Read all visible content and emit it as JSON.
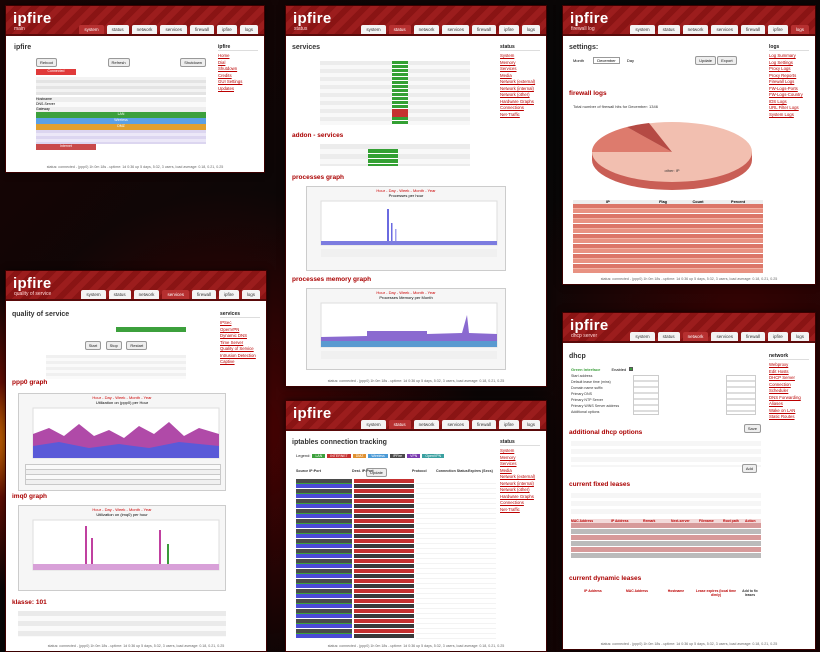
{
  "brand": "ipfire",
  "status_text": "status: connected - (ppp0) 1h 0m 18s - uptime: 1d 0:36 up 5 days, 5:32, 3 users, load average: 0.18, 0.21, 0.25",
  "tabs": [
    "system",
    "status",
    "network",
    "services",
    "firewall",
    "ipfire",
    "logs"
  ],
  "panels": {
    "ipfire": {
      "subtitle": "main",
      "title": "ipfire",
      "buttons": [
        "Reboot",
        "Refresh",
        "Shutdown"
      ],
      "connected": "Connected",
      "row_labels": [
        "Hostname",
        "DNS-Server",
        "Gateway",
        "LAN",
        "Wireless",
        "DMZ",
        "Internet"
      ],
      "sidebar_title": "ipfire",
      "sidebar": [
        "Home",
        "Dial",
        "Shutdown",
        "Credits",
        "GUI Settings",
        "Updates"
      ]
    },
    "services": {
      "subtitle": "status",
      "title": "services",
      "addon_title": "addon - services",
      "graph1_title": "processes graph",
      "graph1_heading": "Processes per hour",
      "graph2_title": "processes memory graph",
      "graph2_heading": "Processes Memory per Month",
      "range_links": "Hour - Day - Week - Month - Year",
      "running": "RUNNING",
      "stopped": "STOPPED",
      "sidebar_title": "status",
      "sidebar": [
        "System",
        "Memory",
        "Services",
        "Media",
        "Network (external)",
        "Network (internal)",
        "Network (other)",
        "Hardware Graphs",
        "Connections",
        "Net-Traffic"
      ]
    },
    "logs": {
      "subtitle": "firewall log",
      "title": "settings:",
      "fwlogs_title": "firewall logs",
      "bar_caption": "Total number of firewall hits for December: 1346",
      "month_label": "Month",
      "month_value": "December",
      "day_label": "Day",
      "update_btn": "Update",
      "export_btn": "Export",
      "pie_label": "other: IP",
      "cols": [
        "IP",
        "Flag",
        "Count",
        "Percent"
      ],
      "sidebar_title": "logs",
      "sidebar": [
        "Log Summary",
        "Log Settings",
        "Proxy Logs",
        "Proxy Reports",
        "Firewall Logs",
        "FW-Logs-Ports",
        "FW-Logs-Country",
        "IDS Logs",
        "URL Filter Logs",
        "System Logs"
      ]
    },
    "qos": {
      "subtitle": "quality of service",
      "title": "quality of service",
      "graph1_title": "ppp0 graph",
      "graph1_heading": "Utilization on (ppp0) per Hour",
      "graph2_title": "imq0 graph",
      "graph2_heading": "Utilization on (imq0) per hour",
      "classes_title": "klasse: 101",
      "range_links": "Hour - Day - Week - Month - Year",
      "buttons": [
        "Start",
        "Stop",
        "Restart"
      ],
      "sidebar_title": "services",
      "sidebar": [
        "IPSec",
        "OpenVPN",
        "Dynamic DNS",
        "Time Server",
        "Quality of Service",
        "Intrusion Detection",
        "Captive"
      ]
    },
    "conntrack": {
      "title": "iptables connection tracking",
      "legend_label": "Legend:",
      "legend": [
        "LAN",
        "INTERNET",
        "DMZ",
        "Wireless",
        "IPFire",
        "VPN",
        "OpenVPN"
      ],
      "update_btn": "Update",
      "cols": [
        "Source IP:Port",
        "Dest. IP:Port",
        "Protocol",
        "Connection Status",
        "Expires (Secs)"
      ],
      "sidebar_title": "status",
      "sidebar": [
        "System",
        "Memory",
        "Services",
        "Media",
        "Network (external)",
        "Network (internal)",
        "Network (other)",
        "Hardware Graphs",
        "Connections",
        "Net-Traffic"
      ]
    },
    "dhcp": {
      "subtitle": "dhcp server",
      "title": "dhcp",
      "green_iface": "Green Interface",
      "enabled": "Enabled",
      "field_labels": [
        "Start address",
        "Default lease time (mins)",
        "Domain name suffix",
        "Primary DNS",
        "Primary NTP Server",
        "Primary WINS Server address",
        "Additional options"
      ],
      "opts_title": "additional dhcp options",
      "fixed_title": "current fixed leases",
      "dynamic_title": "current dynamic leases",
      "save_btn": "Save",
      "add_btn": "Add",
      "fixed_cols": [
        "MAC Address",
        "IP Address",
        "Remark",
        "Next-server",
        "Filename",
        "Root path",
        "Action"
      ],
      "dyn_cols": [
        "IP Address",
        "MAC Address",
        "Hostname",
        "Lease expires (local time d/m/y)",
        "Add to fix leases"
      ],
      "sidebar_title": "network",
      "sidebar": [
        "Webproxy",
        "Edit Hosts",
        "DHCP Server",
        "Connection Scheduler",
        "DNS Forwarding",
        "Aliases",
        "Wake on LAN",
        "Static Routes"
      ]
    }
  },
  "colors": {
    "brand_red": "#9c1d1d",
    "green": "#3ca03c",
    "running": "#33a033",
    "stopped": "#c53030",
    "blue_row": "#4b4bd6",
    "pink": "#f4a3a3"
  }
}
